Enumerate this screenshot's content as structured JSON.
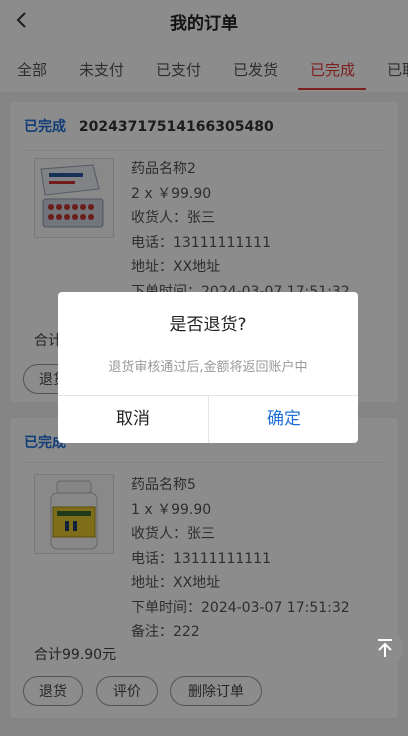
{
  "header": {
    "title": "我的订单"
  },
  "tabs": [
    {
      "label": "全部"
    },
    {
      "label": "未支付"
    },
    {
      "label": "已支付"
    },
    {
      "label": "已发货"
    },
    {
      "label": "已完成"
    },
    {
      "label": "已取"
    }
  ],
  "active_tab": "已完成",
  "orders": [
    {
      "status": "已完成",
      "order_no": "20243717514166305480",
      "name": "药品名称2",
      "qty_price": "2 x ￥99.90",
      "receiver": "收货人：张三",
      "phone": "电话：13111111111",
      "address": "地址：XX地址",
      "time": "下单时间：2024-03-07 17:51:32",
      "total": "合计",
      "buttons": [
        "退货"
      ]
    },
    {
      "status": "已完成",
      "order_no": "",
      "name": "药品名称5",
      "qty_price": "1 x ￥99.90",
      "receiver": "收货人：张三",
      "phone": "电话：13111111111",
      "address": "地址：XX地址",
      "time": "下单时间：2024-03-07 17:51:32",
      "remark": "备注：222",
      "total": "合计99.90元",
      "buttons": [
        "退货",
        "评价",
        "删除订单"
      ]
    }
  ],
  "dialog": {
    "title": "是否退货?",
    "message": "退货审核通过后,金额将返回账户中",
    "cancel": "取消",
    "confirm": "确定"
  },
  "colors": {
    "accent_red": "#e4393c",
    "accent_blue": "#1e6fd9"
  }
}
